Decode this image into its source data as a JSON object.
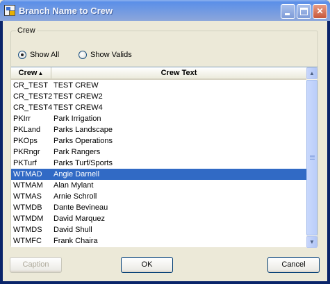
{
  "window": {
    "title": "Branch Name to Crew",
    "controls": {
      "minimize": "minimize-icon",
      "maximize": "maximize-icon",
      "close": "close-icon"
    }
  },
  "group": {
    "label": "Crew",
    "radios": [
      {
        "label": "Show All",
        "checked": true
      },
      {
        "label": "Show Valids",
        "checked": false
      }
    ]
  },
  "grid": {
    "columns": [
      {
        "label": "Crew",
        "sort": "ascending"
      },
      {
        "label": "Crew Text"
      }
    ],
    "rows": [
      {
        "crew": "CR_TEST",
        "text": "TEST CREW",
        "selected": false
      },
      {
        "crew": "CR_TEST2",
        "text": "TEST CREW2",
        "selected": false
      },
      {
        "crew": "CR_TEST4",
        "text": "TEST CREW4",
        "selected": false
      },
      {
        "crew": "PKIrr",
        "text": "Park Irrigation",
        "selected": false
      },
      {
        "crew": "PKLand",
        "text": "Parks Landscape",
        "selected": false
      },
      {
        "crew": "PKOps",
        "text": "Parks Operations",
        "selected": false
      },
      {
        "crew": "PKRngr",
        "text": "Park Rangers",
        "selected": false
      },
      {
        "crew": "PKTurf",
        "text": "Parks Turf/Sports",
        "selected": false
      },
      {
        "crew": "WTMAD",
        "text": "Angie Darnell",
        "selected": true
      },
      {
        "crew": "WTMAM",
        "text": "Alan Mylant",
        "selected": false
      },
      {
        "crew": "WTMAS",
        "text": "Arnie Schroll",
        "selected": false
      },
      {
        "crew": "WTMDB",
        "text": "Dante Bevineau",
        "selected": false
      },
      {
        "crew": "WTMDM",
        "text": "David Marquez",
        "selected": false
      },
      {
        "crew": "WTMDS",
        "text": "David Shull",
        "selected": false
      },
      {
        "crew": "WTMFC",
        "text": "Frank Chaira",
        "selected": false
      }
    ]
  },
  "buttons": {
    "caption": "Caption",
    "ok": "OK",
    "cancel": "Cancel"
  },
  "colors": {
    "selection": "#316AC5",
    "titlebar": "#7A96DF",
    "face": "#ECE9D8"
  }
}
